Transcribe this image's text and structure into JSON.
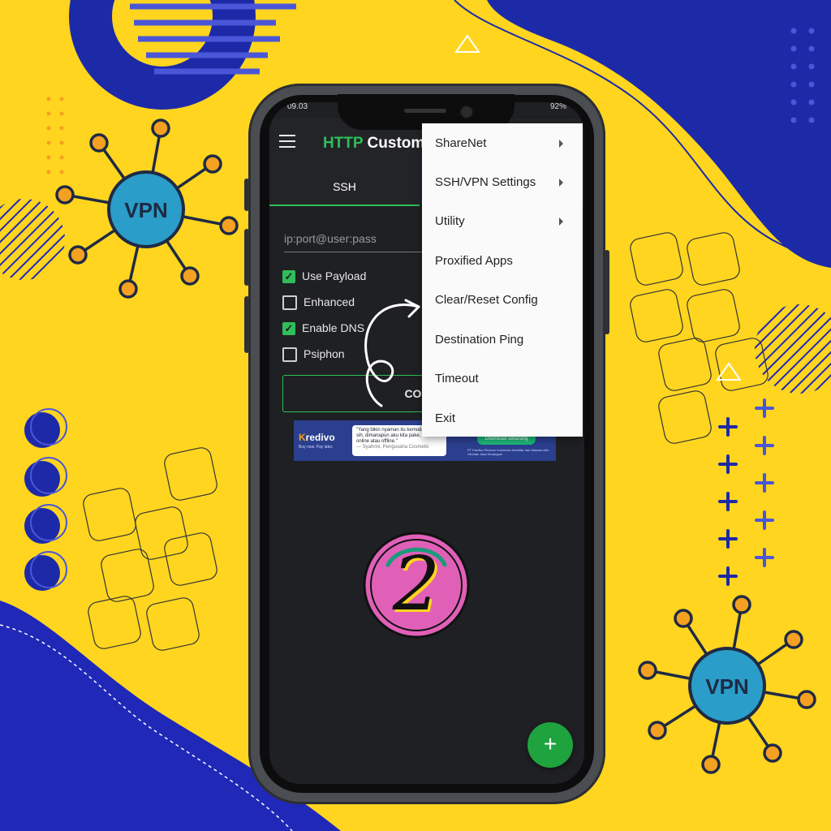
{
  "status_bar": {
    "time": "09.03",
    "battery": "92%"
  },
  "app": {
    "title_colored": "HTTP",
    "title_rest": "Custom",
    "tabs": [
      {
        "label": "SSH"
      }
    ],
    "input_placeholder": "ip:port@user:pass",
    "checkboxes": [
      {
        "label": "Use Payload",
        "checked": true
      },
      {
        "label": "Enhanced",
        "checked": false
      },
      {
        "label": "Enable DNS",
        "checked": true
      },
      {
        "label": "Psiphon",
        "checked": false
      }
    ],
    "connect_label": "CON",
    "fab_label": "+"
  },
  "ad": {
    "logo_k": "K",
    "logo_rest": "redivo",
    "tagline": "Buy now. Pay later.",
    "quote": "\"Yang bikin nyaman itu kemudahannya sih, dimanapun aku kita pake, mau online atau offline.\"",
    "quote_author": "— Syahrini, Pengusaha Cosmetic",
    "button": "Download sekarang",
    "disclaimer": "PT Kredivo Finance Indonesia terdaftar dan diawasi oleh Otoritas Jasa Keuangan"
  },
  "menu": {
    "items": [
      {
        "label": "ShareNet",
        "submenu": true
      },
      {
        "label": "SSH/VPN Settings",
        "submenu": true
      },
      {
        "label": "Utility",
        "submenu": true
      },
      {
        "label": "Proxified Apps",
        "submenu": false
      },
      {
        "label": "Clear/Reset Config",
        "submenu": false
      },
      {
        "label": "Destination Ping",
        "submenu": false
      },
      {
        "label": "Timeout",
        "submenu": false
      },
      {
        "label": "Exit",
        "submenu": false
      }
    ]
  },
  "decor": {
    "badge_left": "VPN",
    "badge_right": "VPN",
    "step_number": "2",
    "colors": {
      "yellow": "#ffd51f",
      "navy": "#1c2aa8",
      "green": "#2fbe5a",
      "pink": "#e060b8",
      "teal": "#2a9dc8",
      "orange": "#f4a020"
    }
  }
}
